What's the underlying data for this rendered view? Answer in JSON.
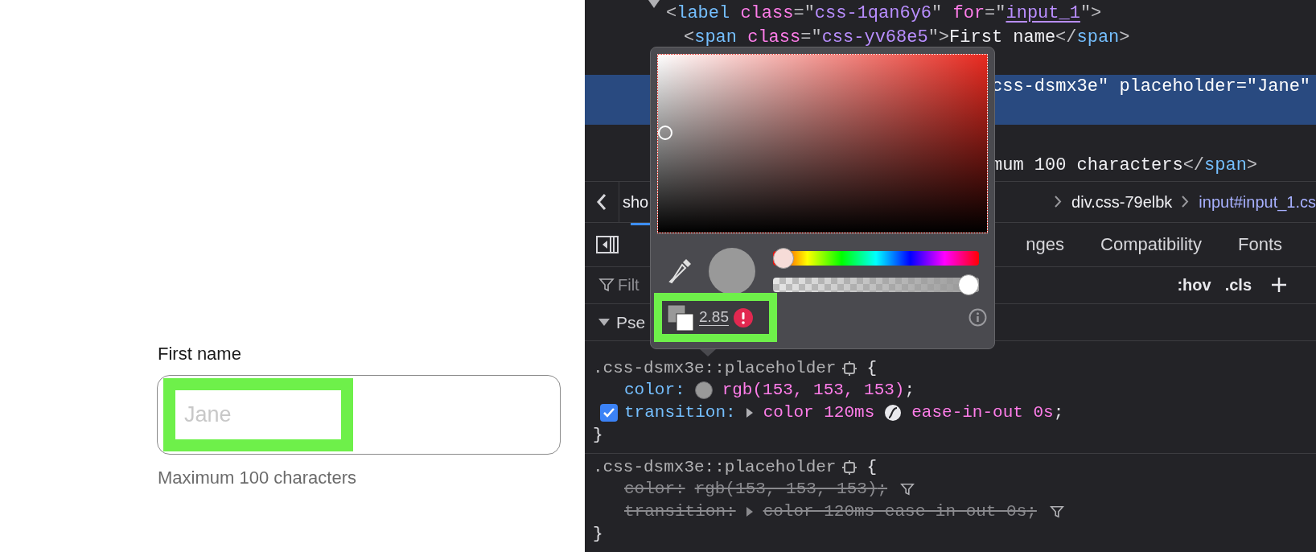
{
  "form": {
    "label": "First name",
    "placeholder": "Jane",
    "placeholder_highlighted": true,
    "hint": "Maximum 100 characters"
  },
  "markup": [
    {
      "kind": "element",
      "expanded": true,
      "selected": false,
      "tokens": [
        {
          "kind": "punct",
          "text": "<"
        },
        {
          "kind": "tag",
          "text": "label"
        },
        {
          "kind": "attr",
          "text": " class"
        },
        {
          "kind": "punct",
          "text": "=\""
        },
        {
          "kind": "value",
          "text": "css-1qan6y6"
        },
        {
          "kind": "punct",
          "text": "\" "
        },
        {
          "kind": "attr",
          "text": "for"
        },
        {
          "kind": "punct",
          "text": "=\""
        },
        {
          "kind": "link",
          "text": "input_1"
        },
        {
          "kind": "punct",
          "text": "\">"
        }
      ],
      "children": [
        {
          "kind": "element",
          "selected": false,
          "tokens": [
            {
              "kind": "punct",
              "text": "<"
            },
            {
              "kind": "tag",
              "text": "span"
            },
            {
              "kind": "attr",
              "text": " class"
            },
            {
              "kind": "punct",
              "text": "=\""
            },
            {
              "kind": "value",
              "text": "css-yv68e5"
            },
            {
              "kind": "punct",
              "text": "\">"
            },
            {
              "kind": "text",
              "text": "First name"
            },
            {
              "kind": "punct",
              "text": "</"
            },
            {
              "kind": "tag",
              "text": "span"
            },
            {
              "kind": "punct",
              "text": ">"
            }
          ]
        },
        {
          "kind": "clipped",
          "selected": true,
          "tokens": [
            {
              "kind": "text",
              "text": "css-dsmx3e\" placeholder=\"Jane\""
            }
          ]
        },
        {
          "kind": "clipped",
          "selected": false,
          "tokens": [
            {
              "kind": "text",
              "text": "mum 100 characters"
            },
            {
              "kind": "punct",
              "text": "</"
            },
            {
              "kind": "tag",
              "text": "span"
            },
            {
              "kind": "punct",
              "text": ">"
            }
          ]
        }
      ]
    }
  ],
  "breadcrumbs": [
    {
      "text": "sho",
      "selected": false
    },
    {
      "text": "div.css-79elbk",
      "selected": false
    },
    {
      "text": "input#input_1.cs",
      "selected": true
    }
  ],
  "tabs": [
    {
      "label": "nges",
      "selected": false
    },
    {
      "label": "Compatibility",
      "selected": false
    },
    {
      "label": "Fonts",
      "selected": false
    }
  ],
  "filter": {
    "placeholder": "Filt"
  },
  "toolbar": [
    ":hov",
    ".cls"
  ],
  "section": {
    "title": "Pse",
    "expanded": true
  },
  "rules": [
    {
      "selector": ".css-dsmx3e::placeholder",
      "open": "{",
      "close": "}",
      "declarations": [
        {
          "property": "color:",
          "overridden": false,
          "parts": [
            {
              "kind": "swatch",
              "color": "#999999"
            },
            {
              "kind": "value",
              "text": "rgb(153, 153, 153)"
            },
            {
              "kind": "punct",
              "text": ";"
            }
          ]
        },
        {
          "property": "transition:",
          "overridden": false,
          "checked": true,
          "parts": [
            {
              "kind": "expander"
            },
            {
              "kind": "value",
              "text": "color 120ms"
            },
            {
              "kind": "easing"
            },
            {
              "kind": "value",
              "text": "ease-in-out 0s"
            },
            {
              "kind": "punct",
              "text": ";"
            }
          ]
        }
      ]
    },
    {
      "selector": ".css-dsmx3e::placeholder",
      "open": "{",
      "close": "}",
      "declarations": [
        {
          "property": "color:",
          "overridden": true,
          "parts": [
            {
              "kind": "value",
              "text": "rgb(153, 153, 153)"
            },
            {
              "kind": "punct",
              "text": ";"
            }
          ]
        },
        {
          "property": "transition:",
          "overridden": true,
          "parts": [
            {
              "kind": "expander"
            },
            {
              "kind": "value",
              "text": "color 120ms ease-in-out 0s"
            },
            {
              "kind": "punct",
              "text": ";"
            }
          ]
        }
      ]
    }
  ],
  "color_picker": {
    "color": "#999999",
    "hue": {
      "level": 0.0
    },
    "alpha": {
      "level": 1.0
    },
    "contrast": "2.85",
    "contrast_highlighted": true
  }
}
